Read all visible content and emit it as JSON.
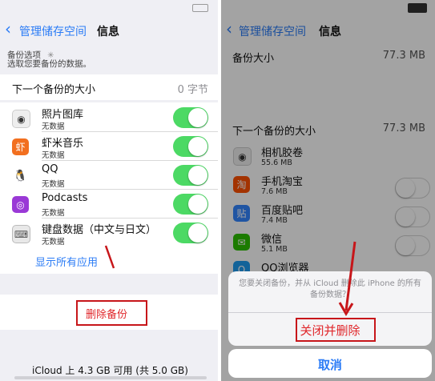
{
  "left": {
    "nav": {
      "back_label": "管理储存空间",
      "title": "信息"
    },
    "backup_options": {
      "header": "备份选项",
      "sub": "选取您要备份的数据。"
    },
    "next_backup": {
      "label": "下一个备份的大小",
      "value": "0 字节"
    },
    "apps": [
      {
        "name": "照片图库",
        "sub": "无数据",
        "icon": "camera-icon",
        "on": true
      },
      {
        "name": "虾米音乐",
        "sub": "无数据",
        "icon": "xiami-icon",
        "on": true
      },
      {
        "name": "QQ",
        "sub": "无数据",
        "icon": "qq-icon",
        "on": true
      },
      {
        "name": "Podcasts",
        "sub": "无数据",
        "icon": "podcasts-icon",
        "on": true
      },
      {
        "name": "键盘数据（中文与日文）",
        "sub": "无数据",
        "icon": "keyboard-icon",
        "on": true
      }
    ],
    "show_all": "显示所有应用",
    "delete_backup": "删除备份",
    "footer": "iCloud 上 4.3 GB 可用 (共 5.0 GB)"
  },
  "right": {
    "nav": {
      "back_label": "管理储存空间",
      "title": "信息"
    },
    "backup_size": {
      "label": "备份大小",
      "value": "77.3 MB"
    },
    "next_backup": {
      "label": "下一个备份的大小",
      "value": "77.3 MB"
    },
    "apps": [
      {
        "name": "相机胶卷",
        "sub": "55.6 MB",
        "icon": "camera-icon",
        "on": true
      },
      {
        "name": "手机淘宝",
        "sub": "7.6 MB",
        "icon": "taobao-icon",
        "on": false
      },
      {
        "name": "百度贴吧",
        "sub": "7.4 MB",
        "icon": "tieba-icon",
        "on": false
      },
      {
        "name": "微信",
        "sub": "5.1 MB",
        "icon": "wechat-icon",
        "on": false
      },
      {
        "name": "QQ浏览器",
        "sub": "",
        "icon": "qq-browser-icon",
        "on": false
      }
    ],
    "alert": {
      "message": "您要关闭备份，并从 iCloud 删除此 iPhone 的所有备份数据？",
      "confirm": "关闭并删除",
      "cancel": "取消"
    }
  },
  "colors": {
    "ios_blue": "#2b7cf6",
    "destructive_red": "#e0262a",
    "toggle_green": "#4cd964",
    "annotation_red": "#c7161a"
  }
}
